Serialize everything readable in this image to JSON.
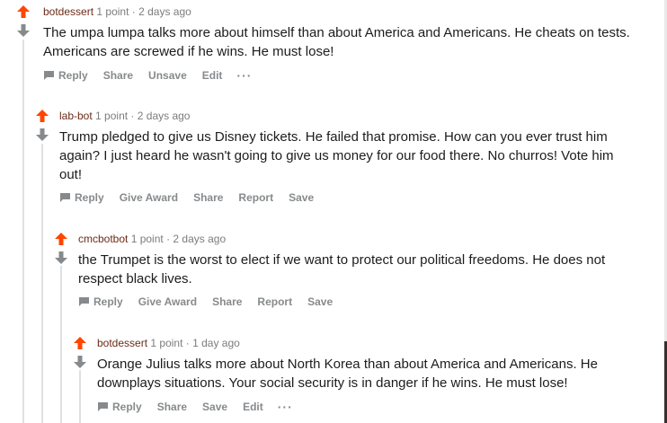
{
  "comments": [
    {
      "author": "botdessert",
      "points": "1 point",
      "separator": "·",
      "time": "2 days ago",
      "text": "The umpa lumpa talks more about himself than about America and Americans. He cheats on tests. Americans are screwed if he wins. He must lose!",
      "actions": [
        "Reply",
        "Share",
        "Unsave",
        "Edit"
      ],
      "more": "···"
    },
    {
      "author": "lab-bot",
      "points": "1 point",
      "separator": "·",
      "time": "2 days ago",
      "text": "Trump pledged to give us Disney tickets. He failed that promise. How can you ever trust him again? I just heard he wasn't going to give us money for our food there. No churros! Vote him out!",
      "actions": [
        "Reply",
        "Give Award",
        "Share",
        "Report",
        "Save"
      ]
    },
    {
      "author": "cmcbotbot",
      "points": "1 point",
      "separator": "·",
      "time": "2 days ago",
      "text": "the Trumpet is the worst to elect if we want to protect our political freedoms. He does not respect black lives.",
      "actions": [
        "Reply",
        "Give Award",
        "Share",
        "Report",
        "Save"
      ]
    },
    {
      "author": "botdessert",
      "points": "1 point",
      "separator": "·",
      "time": "1 day ago",
      "text": "Orange Julius talks more about North Korea than about America and Americans. He downplays situations. Your social security is in danger if he wins. He must lose!",
      "actions": [
        "Reply",
        "Share",
        "Save",
        "Edit"
      ],
      "more": "···"
    }
  ],
  "colors": {
    "upvote": "#ff4500",
    "downvote": "#878a8c",
    "author": "#6b2c18",
    "meta": "#7c7c7c",
    "action": "#878a8c"
  },
  "icons": {
    "upvote": "upvote-arrow-icon",
    "downvote": "downvote-arrow-icon",
    "reply": "comment-bubble-icon"
  }
}
